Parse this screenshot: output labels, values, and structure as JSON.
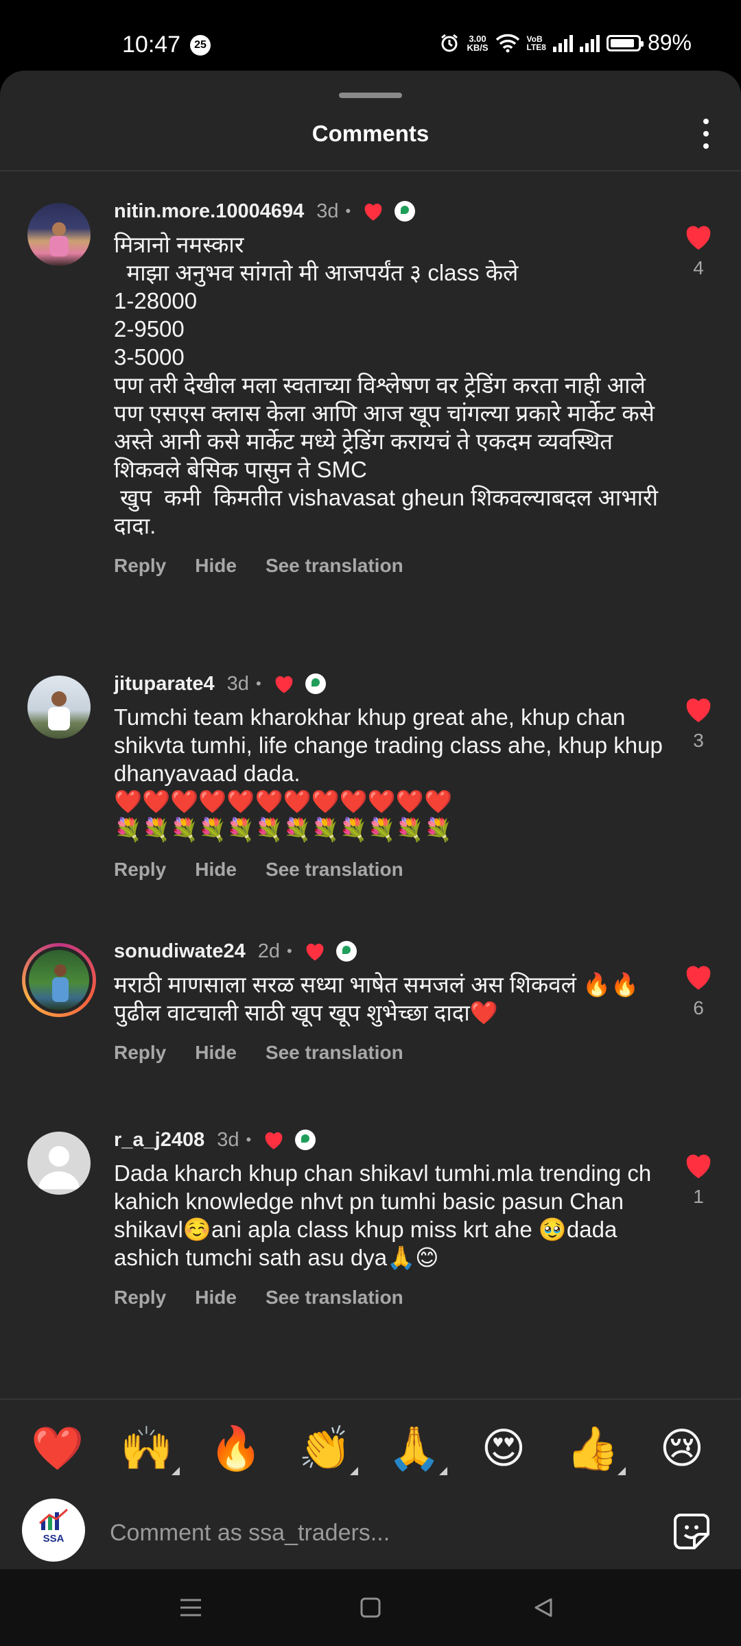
{
  "status_bar": {
    "time": "10:47",
    "notification_count": "25",
    "net_speed_value": "3.00",
    "net_speed_unit": "KB/S",
    "volte_line1": "VoB",
    "volte_line2": "LTE8",
    "battery_level": 0.89,
    "battery_percent": "89%"
  },
  "sheet": {
    "title": "Comments"
  },
  "comments": [
    {
      "username": "nitin.more.10004694",
      "time": "3d",
      "text": "मित्रानो नमस्कार\n  माझा अनुभव सांगतो मी आजपर्यंत ३ class केले\n1-28000\n2-9500\n3-5000\nपण तरी देखील मला स्वताच्या विश्लेषण वर ट्रेडिंग करता नाही आले पण एसएस क्लास केला आणि आज खूप चांगल्या प्रकारे मार्केट कसे अस्ते आनी कसे मार्केट मध्ये ट्रेडिंग करायचं ते एकदम व्यवस्थित शिकवले बेसिक पासुन ते SMC\n खुप  कमी  किमतीत vishavasat gheun शिकवल्याबदल आभारी दादा.",
      "reply": "Reply",
      "hide": "Hide",
      "translate": "See translation",
      "likes": "4"
    },
    {
      "username": "jituparate4",
      "time": "3d",
      "text": "Tumchi team kharokhar khup great ahe, khup chan shikvta tumhi, life change trading class ahe, khup khup dhanyavaad dada.\n❤️❤️❤️❤️❤️❤️❤️❤️❤️❤️❤️❤️\n💐💐💐💐💐💐💐💐💐💐💐💐",
      "reply": "Reply",
      "hide": "Hide",
      "translate": "See translation",
      "likes": "3"
    },
    {
      "username": "sonudiwate24",
      "time": "2d",
      "text": "मराठी माणसाला सरळ सध्या भाषेत समजलं अस शिकवलं 🔥🔥पुढील वाटचाली साठी खूप खूप शुभेच्छा दादा❤️",
      "reply": "Reply",
      "hide": "Hide",
      "translate": "See translation",
      "likes": "6"
    },
    {
      "username": "r_a_j2408",
      "time": "3d",
      "text": "Dada kharch khup chan shikavl tumhi.mla trending ch kahich knowledge nhvt pn tumhi basic pasun Chan shikavl☺️ani apla class khup miss krt ahe 🥹dada ashich tumchi sath asu dya🙏😊",
      "reply": "Reply",
      "hide": "Hide",
      "translate": "See translation",
      "likes": "1"
    }
  ],
  "quick_reactions": [
    "❤️",
    "🙌",
    "🔥",
    "👏",
    "🙏",
    "😍",
    "👍",
    "😢"
  ],
  "composer": {
    "avatar_label": "SSA",
    "placeholder": "Comment as ssa_traders..."
  },
  "colors": {
    "sheet_bg": "#262626",
    "like_red": "#ff3040",
    "secondary_text": "#a8a8a8"
  }
}
